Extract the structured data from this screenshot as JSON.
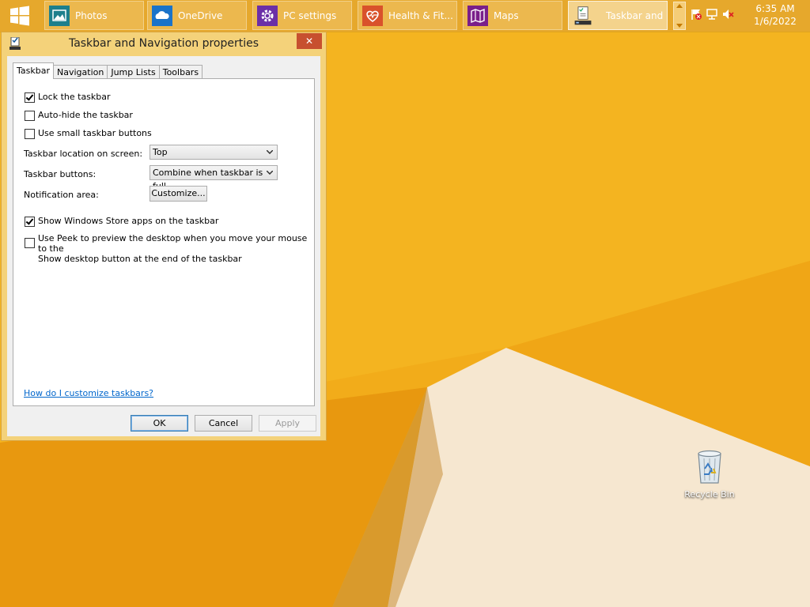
{
  "taskbar": {
    "apps": [
      {
        "label": "Photos",
        "icon": "photos-icon",
        "color": "#1e7f8c"
      },
      {
        "label": "OneDrive",
        "icon": "onedrive-icon",
        "color": "#1a73c9"
      },
      {
        "label": "PC settings",
        "icon": "gear-icon",
        "color": "#6b2fa7"
      },
      {
        "label": "Health & Fit...",
        "icon": "heart-icon",
        "color": "#d9522b"
      },
      {
        "label": "Maps",
        "icon": "maps-icon",
        "color": "#7a1f8a"
      },
      {
        "label": "Taskbar and ...",
        "icon": "taskbar-properties-icon",
        "color": "#ffffff"
      }
    ],
    "tray_icons": [
      "action-center-flag-icon",
      "network-icon",
      "volume-muted-icon"
    ],
    "clock": {
      "time": "6:35 AM",
      "date": "1/6/2022"
    }
  },
  "dialog": {
    "title": "Taskbar and Navigation properties",
    "close_label": "✕",
    "tabs": [
      "Taskbar",
      "Navigation",
      "Jump Lists",
      "Toolbars"
    ],
    "selected_tab": "Taskbar",
    "options": {
      "lock_taskbar": {
        "label": "Lock the taskbar",
        "checked": true
      },
      "auto_hide": {
        "label": "Auto-hide the taskbar",
        "checked": false
      },
      "small_buttons": {
        "label": "Use small taskbar buttons",
        "checked": false
      },
      "show_store_apps": {
        "label": "Show Windows Store apps on the taskbar",
        "checked": true
      },
      "use_peek": {
        "label_line1": "Use Peek to preview the desktop when you move your mouse to the",
        "label_line2": "Show desktop button at the end of the taskbar",
        "checked": false
      }
    },
    "location_label": "Taskbar location on screen:",
    "location_value": "Top",
    "buttons_label": "Taskbar buttons:",
    "buttons_value": "Combine when taskbar is full",
    "notification_label": "Notification area:",
    "customize_label": "Customize...",
    "help_link": "How do I customize taskbars?",
    "ok_label": "OK",
    "cancel_label": "Cancel",
    "apply_label": "Apply"
  },
  "desktop": {
    "recycle_bin_label": "Recycle Bin",
    "accent": "#f0a818"
  }
}
